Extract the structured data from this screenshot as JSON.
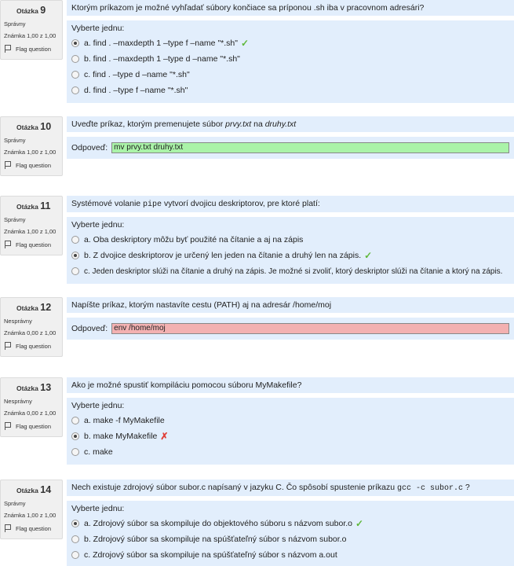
{
  "common": {
    "question_word": "Otázka",
    "select_one": "Vyberte jednu:",
    "answer_label": "Odpoveď:",
    "flag": "Flag question"
  },
  "questions": [
    {
      "number": "9",
      "state": "Správny",
      "grade": "Známka 1,00 z 1,00",
      "text": "Ktorým príkazom je možné vyhľadať súbory končiace sa príponou .sh iba v pracovnom adresári?",
      "options": [
        {
          "label": "a. find . –maxdepth 1 –type f –name \"*.sh\"",
          "checked": true,
          "mark": "tick"
        },
        {
          "label": "b. find . –maxdepth 1 –type d –name \"*.sh\"",
          "checked": false
        },
        {
          "label": "c. find . –type d –name \"*.sh\"",
          "checked": false
        },
        {
          "label": "d. find . –type f –name \"*.sh\"",
          "checked": false
        }
      ]
    },
    {
      "number": "10",
      "state": "Správny",
      "grade": "Známka 1,00 z 1,00",
      "text_parts": [
        "Uveďte príkaz, ktorým premenujete súbor ",
        "prvy.txt",
        " na ",
        "druhy.txt"
      ],
      "answer": "mv prvy.txt druhy.txt"
    },
    {
      "number": "11",
      "state": "Správny",
      "grade": "Známka 1,00 z 1,00",
      "text_parts": [
        "Systémové volanie ",
        "pipe",
        " vytvorí dvojicu deskriptorov, pre ktoré platí:"
      ],
      "options": [
        {
          "label": "a. Oba deskriptory môžu byť použité na čítanie a aj na zápis",
          "checked": false
        },
        {
          "label": "b. Z dvojice deskriptorov je určený len jeden na čítanie a druhý len na zápis.",
          "checked": true,
          "mark": "tick"
        },
        {
          "label": "c. Jeden deskriptor slúži na čítanie a druhý na zápis. Je možné si zvoliť, ktorý deskriptor slúži na čítanie a ktorý na zápis.",
          "checked": false
        }
      ]
    },
    {
      "number": "12",
      "state": "Nesprávny",
      "grade": "Známka 0,00 z 1,00",
      "text": "Napíšte príkaz, ktorým nastavíte cestu  (PATH) aj  na adresár /home/moj",
      "answer": "env /home/moj"
    },
    {
      "number": "13",
      "state": "Nesprávny",
      "grade": "Známka 0,00 z 1,00",
      "text": "Ako je možné spustiť kompiláciu pomocou súboru MyMakefile?",
      "options": [
        {
          "label": "a. make -f MyMakefile",
          "checked": false
        },
        {
          "label": "b. make MyMakefile",
          "checked": true,
          "mark": "cross"
        },
        {
          "label": "c. make",
          "checked": false
        }
      ]
    },
    {
      "number": "14",
      "state": "Správny",
      "grade": "Známka 1,00 z 1,00",
      "text_parts": [
        "Nech existuje zdrojový súbor subor.c napísaný v jazyku C. Čo spôsobí spustenie príkazu ",
        "gcc -c subor.c",
        " ?"
      ],
      "options": [
        {
          "label": "a. Zdrojový súbor sa skompiluje do objektového súboru s názvom subor.o",
          "checked": true,
          "mark": "tick"
        },
        {
          "label": "b. Zdrojový súbor sa skompiluje na spúšťateľný súbor s názvom subor.o",
          "checked": false
        },
        {
          "label": "c. Zdrojový súbor sa skompiluje na spúšťateľný súbor s názvom a.out",
          "checked": false
        }
      ]
    }
  ],
  "colors": {
    "content_bg": "#e2eefc",
    "info_bg": "#f0f0f0",
    "correct_field": "#aaf3a8",
    "incorrect_field": "#f3b1b1",
    "tick": "#5fb83a",
    "cross": "#e0413a"
  },
  "icons": [
    "flag-icon",
    "check-icon",
    "cross-icon",
    "radio-button"
  ]
}
